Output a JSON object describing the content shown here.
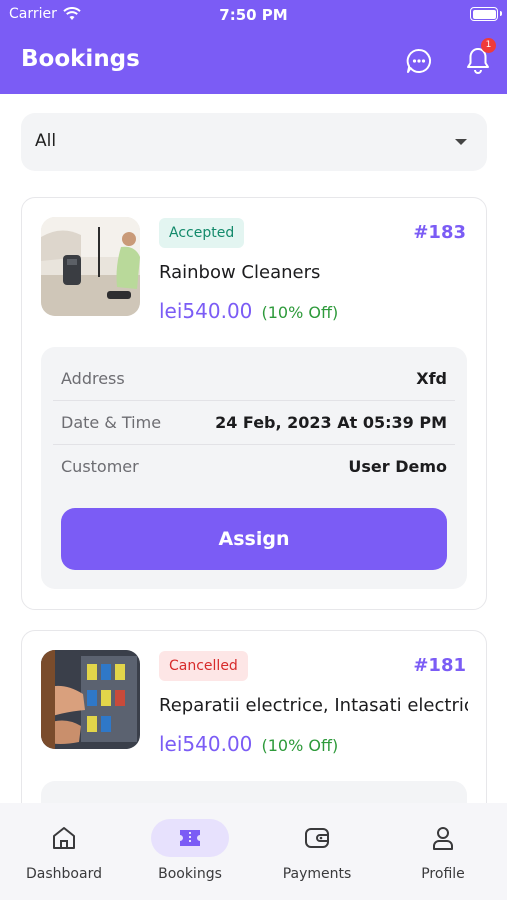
{
  "status_bar": {
    "carrier": "Carrier",
    "time": "7:50 PM"
  },
  "header": {
    "title": "Bookings",
    "notification_count": "1"
  },
  "filter": {
    "selected": "All"
  },
  "bookings": [
    {
      "status": "Accepted",
      "id": "#183",
      "service": "Rainbow Cleaners",
      "price": "lei540.00",
      "discount": "(10% Off)",
      "details": [
        {
          "label": "Address",
          "value": "Xfd"
        },
        {
          "label": "Date & Time",
          "value": "24 Feb, 2023 At 05:39 PM"
        },
        {
          "label": "Customer",
          "value": "User Demo"
        }
      ],
      "action_label": "Assign"
    },
    {
      "status": "Cancelled",
      "id": "#181",
      "service": "Reparatii electrice, Intasati electrice",
      "price": "lei540.00",
      "discount": "(10% Off)"
    }
  ],
  "nav": [
    {
      "label": "Dashboard",
      "icon": "home-icon",
      "active": false
    },
    {
      "label": "Bookings",
      "icon": "ticket-icon",
      "active": true
    },
    {
      "label": "Payments",
      "icon": "wallet-icon",
      "active": false
    },
    {
      "label": "Profile",
      "icon": "user-icon",
      "active": false
    }
  ],
  "colors": {
    "primary": "#7b5cf5",
    "accepted": "#138a6b",
    "cancelled": "#d72b2b",
    "discount": "#2e9a3b"
  }
}
